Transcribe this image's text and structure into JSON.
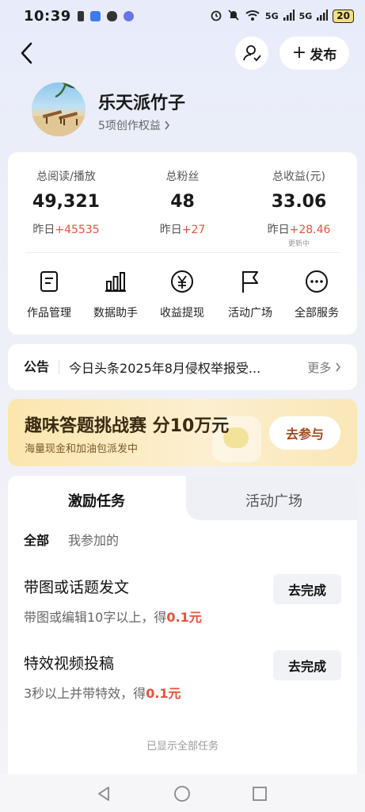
{
  "status_bar": {
    "time": "10:39",
    "network_1": "5G",
    "network_2": "5G",
    "battery": "20"
  },
  "header": {
    "publish_label": "发布"
  },
  "profile": {
    "username": "乐天派竹子",
    "rights": "5项创作权益"
  },
  "stats": [
    {
      "label": "总阅读/播放",
      "value": "49,321",
      "delta_prefix": "昨日",
      "delta": "+45535"
    },
    {
      "label": "总粉丝",
      "value": "48",
      "delta_prefix": "昨日",
      "delta": "+27"
    },
    {
      "label": "总收益(元)",
      "value": "33.06",
      "delta_prefix": "昨日",
      "delta": "+28.46",
      "sub": "更新中"
    }
  ],
  "services": [
    {
      "label": "作品管理",
      "icon": "document-icon"
    },
    {
      "label": "数据助手",
      "icon": "bar-chart-icon"
    },
    {
      "label": "收益提现",
      "icon": "yuan-icon"
    },
    {
      "label": "活动广场",
      "icon": "flag-icon"
    },
    {
      "label": "全部服务",
      "icon": "more-icon"
    }
  ],
  "notice": {
    "tag": "公告",
    "text": "今日头条2025年8月侵权举报受...",
    "more": "更多"
  },
  "banner": {
    "title": "趣味答题挑战赛 分10万元",
    "subtitle": "海量现金和加油包派发中",
    "button": "去参与"
  },
  "tasks_panel": {
    "tabs": [
      "激励任务",
      "活动广场"
    ],
    "filters": [
      "全部",
      "我参加的"
    ],
    "tasks": [
      {
        "title": "带图或话题发文",
        "desc": "带图或编辑10字以上，得",
        "reward": "0.1元",
        "button": "去完成"
      },
      {
        "title": "特效视频投稿",
        "desc": "3秒以上并带特效，得",
        "reward": "0.1元",
        "button": "去完成"
      }
    ],
    "footer": "已显示全部任务"
  },
  "colors": {
    "accent_red": "#e8513c",
    "banner_button_text": "#a0481e"
  }
}
